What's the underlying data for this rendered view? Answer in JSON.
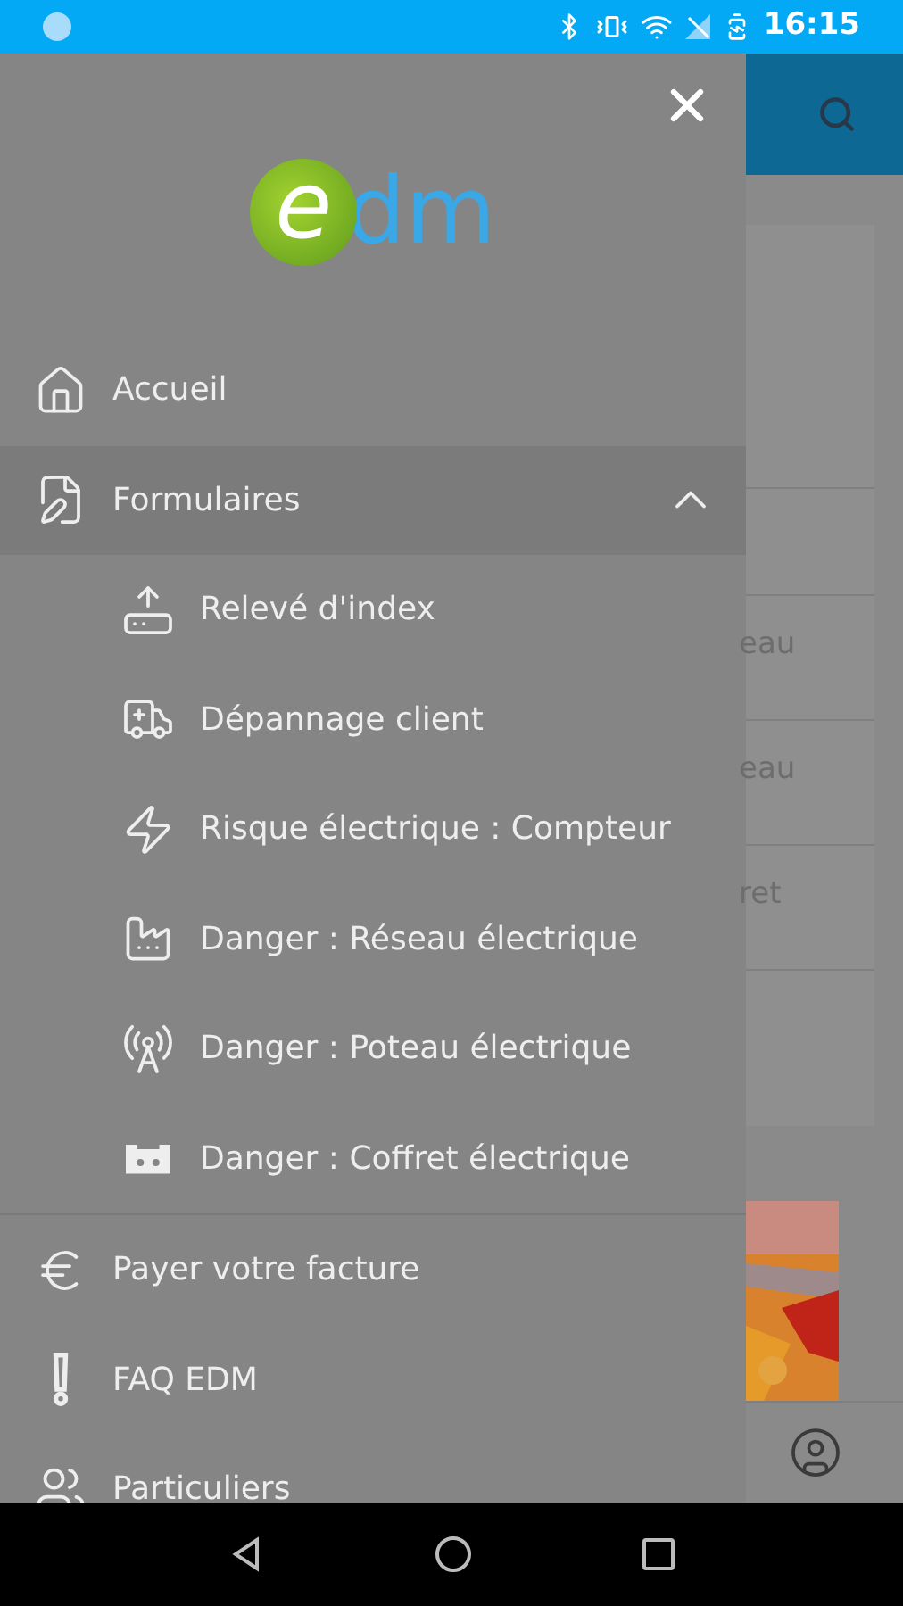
{
  "status_bar": {
    "time": "16:15"
  },
  "background": {
    "fragments": [
      "eau",
      "eau",
      "ret"
    ]
  },
  "drawer": {
    "logo": {
      "mark": "e",
      "text": "dm"
    },
    "menu": [
      {
        "kind": "item",
        "label": "Accueil"
      },
      {
        "kind": "group",
        "label": "Formulaires",
        "expanded": true,
        "children": [
          {
            "label": "Relevé d'index"
          },
          {
            "label": "Dépannage client"
          },
          {
            "label": "Risque électrique : Compteur"
          },
          {
            "label": "Danger : Réseau électrique"
          },
          {
            "label": "Danger : Poteau électrique"
          },
          {
            "label": "Danger : Coffret électrique"
          }
        ]
      },
      {
        "kind": "divider"
      },
      {
        "kind": "item",
        "label": "Payer votre facture"
      },
      {
        "kind": "item",
        "label": "FAQ EDM"
      },
      {
        "kind": "item",
        "label": "Particuliers"
      }
    ]
  }
}
